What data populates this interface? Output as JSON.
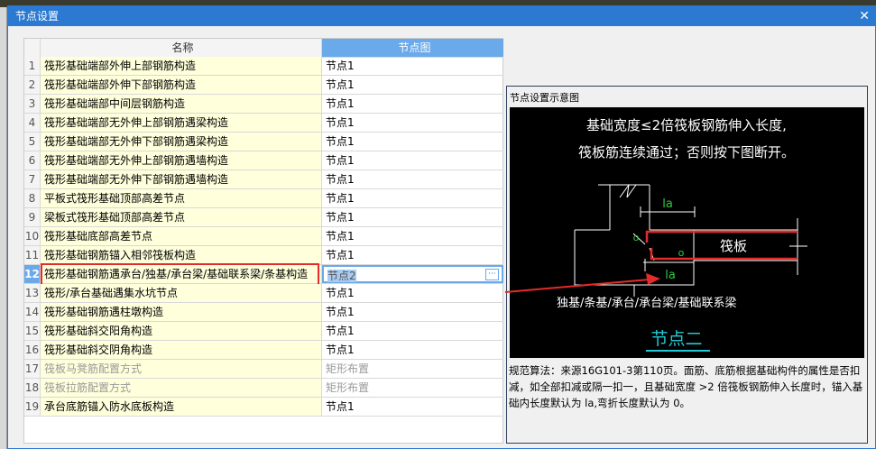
{
  "window": {
    "title": "节点设置",
    "close_icon": "close-icon"
  },
  "table": {
    "headers": {
      "name": "名称",
      "node": "节点图"
    },
    "rows": [
      {
        "n": "1",
        "name": "筏形基础端部外伸上部钢筋构造",
        "node": "节点1"
      },
      {
        "n": "2",
        "name": "筏形基础端部外伸下部钢筋构造",
        "node": "节点1"
      },
      {
        "n": "3",
        "name": "筏形基础端部中间层钢筋构造",
        "node": "节点1"
      },
      {
        "n": "4",
        "name": "筏形基础端部无外伸上部钢筋遇梁构造",
        "node": "节点1"
      },
      {
        "n": "5",
        "name": "筏形基础端部无外伸下部钢筋遇梁构造",
        "node": "节点1"
      },
      {
        "n": "6",
        "name": "筏形基础端部无外伸上部钢筋遇墙构造",
        "node": "节点1"
      },
      {
        "n": "7",
        "name": "筏形基础端部无外伸下部钢筋遇墙构造",
        "node": "节点1"
      },
      {
        "n": "8",
        "name": "平板式筏形基础顶部高差节点",
        "node": "节点1"
      },
      {
        "n": "9",
        "name": "梁板式筏形基础顶部高差节点",
        "node": "节点1"
      },
      {
        "n": "10",
        "name": "筏形基础底部高差节点",
        "node": "节点1"
      },
      {
        "n": "11",
        "name": "筏形基础钢筋锚入相邻筏板构造",
        "node": "节点1"
      },
      {
        "n": "12",
        "name": "筏形基础钢筋遇承台/独基/承台梁/基础联系梁/条基构造",
        "node": "节点2",
        "selected": true
      },
      {
        "n": "13",
        "name": "筏形/承台基础遇集水坑节点",
        "node": "节点1"
      },
      {
        "n": "14",
        "name": "筏形基础钢筋遇柱墩构造",
        "node": "节点1"
      },
      {
        "n": "15",
        "name": "筏形基础斜交阳角构造",
        "node": "节点1"
      },
      {
        "n": "16",
        "name": "筏形基础斜交阴角构造",
        "node": "节点1"
      },
      {
        "n": "17",
        "name": "筏板马凳筋配置方式",
        "node": "矩形布置",
        "disabled": true
      },
      {
        "n": "18",
        "name": "筏板拉筋配置方式",
        "node": "矩形布置",
        "disabled": true
      },
      {
        "n": "19",
        "name": "承台底筋锚入防水底板构造",
        "node": "节点1"
      }
    ],
    "more_button": "···"
  },
  "preview": {
    "title": "节点设置示意图",
    "line1": "基础宽度≤2倍筏板钢筋伸入长度,",
    "line2": "筏板筋连续通过；否则按下图断开。",
    "la_top": "la",
    "la_bottom": "la",
    "o1": "o",
    "o2": "o",
    "slab": "筏板",
    "members": "独基/条基/承台/承台梁/基础联系梁",
    "node_caption": "节点二",
    "description": "规范算法：来源16G101-3第110页。面筋、底筋根据基础构件的属性是否扣减，如全部扣减或隔一扣一，且基础宽度 >2 倍筏板钢筋伸入长度时，锚入基础内长度默认为 la,弯折长度默认为 0。"
  },
  "colors": {
    "title_bar": "#2b79d0",
    "header_selected": "#6aa9ea",
    "name_cell": "#ffffdc",
    "highlight": "#e32b2b",
    "diagram_green": "#2ecc40",
    "diagram_cyan": "#23c8d6"
  }
}
